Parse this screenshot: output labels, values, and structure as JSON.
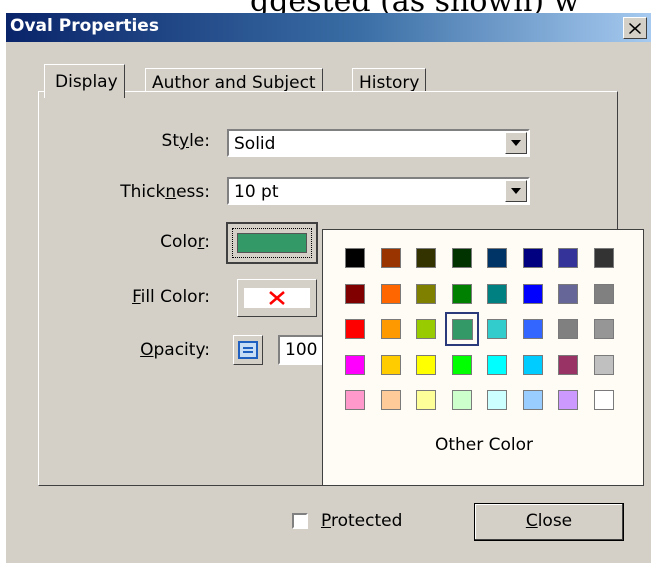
{
  "window": {
    "title": "Oval Properties",
    "caption_fragment": "ggested (as shown) w"
  },
  "tabs": [
    {
      "label": "Display",
      "active": true
    },
    {
      "label": "Author and Subject",
      "active": false
    },
    {
      "label": "History",
      "active": false
    }
  ],
  "display": {
    "style": {
      "label_pre": "St",
      "label_key": "y",
      "label_post": "le:",
      "value": "Solid"
    },
    "thickness": {
      "label_pre": "Thick",
      "label_key": "n",
      "label_post": "ess:",
      "value": "10 pt"
    },
    "color": {
      "label_pre": "Colo",
      "label_key": "r",
      "label_post": ":",
      "value": "#339966"
    },
    "fill_color": {
      "label_pre": "",
      "label_key": "F",
      "label_post": "ill Color:",
      "value": "none"
    },
    "opacity": {
      "label_pre": "",
      "label_key": "O",
      "label_post": "pacity:",
      "value": "100"
    }
  },
  "palette": {
    "selected": "#339966",
    "colors": [
      [
        "#000000",
        "#993300",
        "#333300",
        "#003300",
        "#003366",
        "#000080",
        "#333399",
        "#333333"
      ],
      [
        "#800000",
        "#ff6600",
        "#808000",
        "#008000",
        "#008080",
        "#0000ff",
        "#666699",
        "#808080"
      ],
      [
        "#ff0000",
        "#ff9900",
        "#99cc00",
        "#339966",
        "#33cccc",
        "#3366ff",
        "#808080",
        "#969696"
      ],
      [
        "#ff00ff",
        "#ffcc00",
        "#ffff00",
        "#00ff00",
        "#00ffff",
        "#00ccff",
        "#993366",
        "#c0c0c0"
      ],
      [
        "#ff99cc",
        "#ffcc99",
        "#ffff99",
        "#ccffcc",
        "#ccffff",
        "#99ccff",
        "#cc99ff",
        "#ffffff"
      ]
    ],
    "other_label": "Other Color"
  },
  "footer": {
    "protected": {
      "label_key": "P",
      "label_post": "rotected",
      "checked": false
    },
    "close": {
      "label_key": "C",
      "label_post": "lose"
    }
  }
}
